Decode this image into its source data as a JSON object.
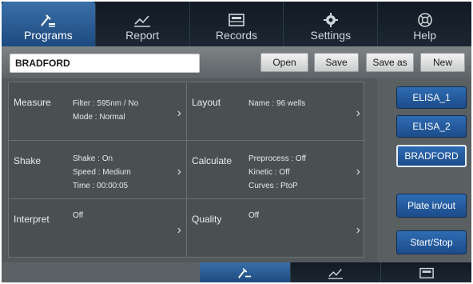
{
  "nav": {
    "tabs": [
      {
        "label": "Programs",
        "icon": "programs-icon",
        "active": true
      },
      {
        "label": "Report",
        "icon": "chart-icon",
        "active": false
      },
      {
        "label": "Records",
        "icon": "records-icon",
        "active": false
      },
      {
        "label": "Settings",
        "icon": "gear-icon",
        "active": false
      },
      {
        "label": "Help",
        "icon": "help-icon",
        "active": false
      }
    ]
  },
  "toolbar": {
    "filename": "BRADFORD",
    "open_label": "Open",
    "save_label": "Save",
    "save_as_label": "Save as",
    "new_label": "New"
  },
  "panel": {
    "measure": {
      "title": "Measure",
      "lines": [
        "Filter :  595nm / No",
        "Mode :  Normal"
      ]
    },
    "layout": {
      "title": "Layout",
      "lines": [
        "Name : 96 wells"
      ]
    },
    "shake": {
      "title": "Shake",
      "lines": [
        "Shake : On",
        "Speed : Medium",
        "Time :  00:00:05"
      ]
    },
    "calculate": {
      "title": "Calculate",
      "lines": [
        "Preprocess : Off",
        "Kinetic :  Off",
        "Curves : PtoP"
      ]
    },
    "interpret": {
      "title": "Interpret",
      "lines": [
        "Off"
      ]
    },
    "quality": {
      "title": "Quality",
      "lines": [
        "Off"
      ]
    }
  },
  "sidebar": {
    "programs": [
      "ELISA_1",
      "ELISA_2",
      "BRADFORD"
    ],
    "selected": "BRADFORD",
    "plate_label": "Plate in/out",
    "start_label": "Start/Stop"
  },
  "colors": {
    "accent": "#2f6cb3",
    "nav_bg": "#111a24",
    "panel_bg": "#4a5052"
  }
}
